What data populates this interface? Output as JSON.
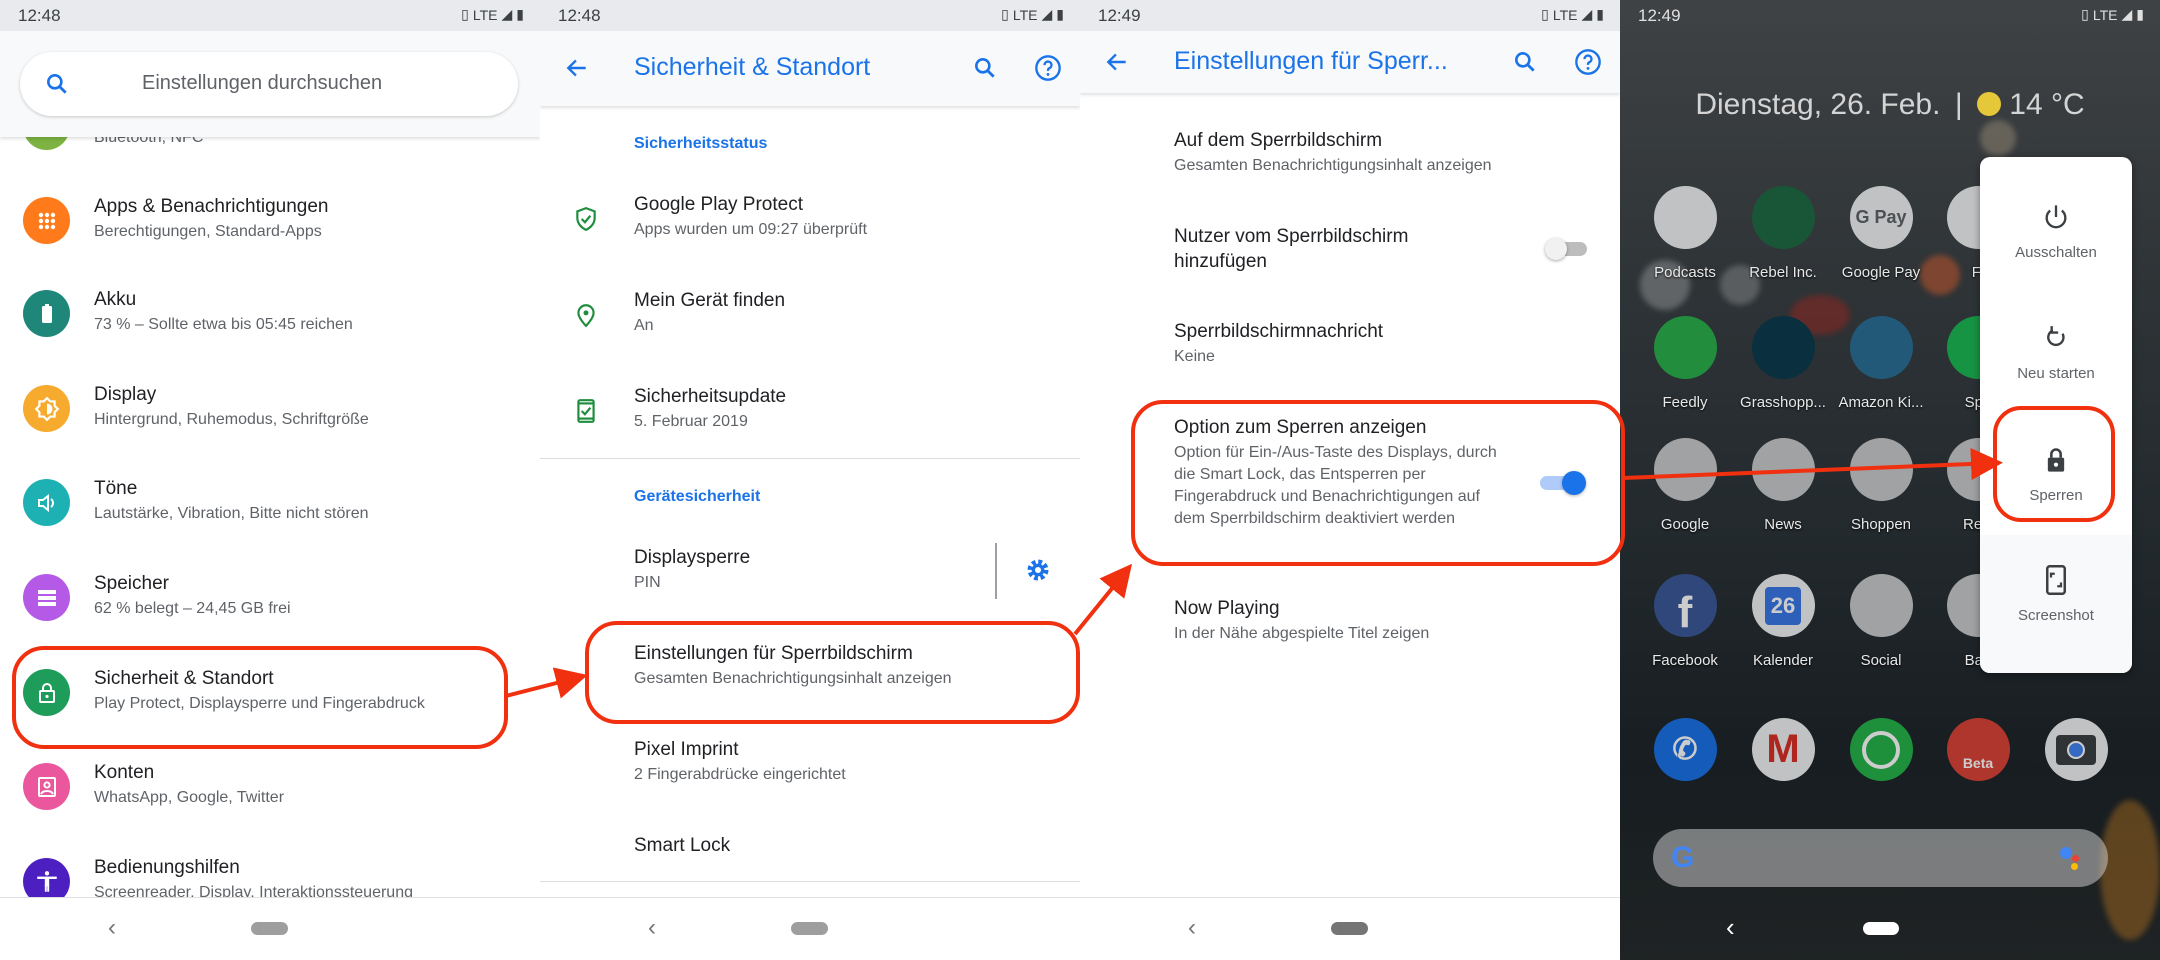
{
  "colors": {
    "accent": "#1a73e8",
    "annotation": "#f0300f",
    "primary_text": "#202124",
    "secondary_text": "#5f6368",
    "shield_green": "#1e8e3e"
  },
  "screen1": {
    "status": {
      "time": "12:48",
      "network": "LTE"
    },
    "search": {
      "placeholder": "Einstellungen durchsuchen",
      "icon": "search-icon"
    },
    "items": [
      {
        "title": "",
        "subtitle": "Bluetooth, NFC",
        "icon": "bluetooth-icon",
        "color": "#7cb342"
      },
      {
        "title": "Apps & Benachrichtigungen",
        "subtitle": "Berechtigungen, Standard-Apps",
        "icon": "apps-grid-icon",
        "color": "#ff7a1a"
      },
      {
        "title": "Akku",
        "subtitle": "73 % – Sollte etwa bis 05:45 reichen",
        "icon": "battery-icon",
        "color": "#1e877a"
      },
      {
        "title": "Display",
        "subtitle": "Hintergrund, Ruhemodus, Schriftgröße",
        "icon": "brightness-icon",
        "color": "#f6ab2f"
      },
      {
        "title": "Töne",
        "subtitle": "Lautstärke, Vibration, Bitte nicht stören",
        "icon": "volume-icon",
        "color": "#1eb1b4"
      },
      {
        "title": "Speicher",
        "subtitle": "62 % belegt – 24,45 GB frei",
        "icon": "storage-icon",
        "color": "#b45ae6"
      },
      {
        "title": "Sicherheit & Standort",
        "subtitle": "Play Protect, Displaysperre und Fingerabdruck",
        "icon": "lock-icon",
        "color": "#1e9c5a"
      },
      {
        "title": "Konten",
        "subtitle": "WhatsApp, Google, Twitter",
        "icon": "account-icon",
        "color": "#ea579c"
      },
      {
        "title": "Bedienungshilfen",
        "subtitle": "Screenreader, Display, Interaktionssteuerung",
        "icon": "accessibility-icon",
        "color": "#4c1fc0"
      }
    ]
  },
  "screen2": {
    "status": {
      "time": "12:48",
      "network": "LTE"
    },
    "appbar": {
      "title": "Sicherheit & Standort"
    },
    "sections": [
      {
        "header": "Sicherheitsstatus",
        "items": [
          {
            "title": "Google Play Protect",
            "subtitle": "Apps wurden um 09:27 überprüft",
            "icon": "shield-check-icon"
          },
          {
            "title": "Mein Gerät finden",
            "subtitle": "An",
            "icon": "location-pin-icon"
          },
          {
            "title": "Sicherheitsupdate",
            "subtitle": "5. Februar 2019",
            "icon": "phone-check-icon"
          }
        ]
      },
      {
        "header": "Gerätesicherheit",
        "items": [
          {
            "title": "Displaysperre",
            "subtitle": "PIN",
            "icon": "gear-icon"
          },
          {
            "title": "Einstellungen für Sperrbildschirm",
            "subtitle": "Gesamten Benachrichtigungsinhalt anzeigen"
          },
          {
            "title": "Pixel Imprint",
            "subtitle": "2 Fingerabdrücke eingerichtet"
          },
          {
            "title": "Smart Lock",
            "subtitle": ""
          }
        ]
      }
    ]
  },
  "screen3": {
    "status": {
      "time": "12:49",
      "network": "LTE"
    },
    "appbar": {
      "title": "Einstellungen für Sperr..."
    },
    "items": [
      {
        "title": "Auf dem Sperrbildschirm",
        "subtitle": "Gesamten Benachrichtigungsinhalt anzeigen"
      },
      {
        "title": "Nutzer vom Sperrbildschirm hinzufügen",
        "subtitle": "",
        "toggle": false
      },
      {
        "title": "Sperrbildschirmnachricht",
        "subtitle": "Keine"
      },
      {
        "title": "Option zum Sperren anzeigen",
        "subtitle": "Option für Ein-/Aus-Taste des Displays, durch die Smart Lock, das Entsperren per Fingerabdruck und Benachrichtigungen auf dem Sperrbildschirm deaktiviert werden",
        "toggle": true
      },
      {
        "title": "Now Playing",
        "subtitle": "In der Nähe abgespielte Titel zeigen"
      }
    ]
  },
  "screen4": {
    "status": {
      "time": "12:49",
      "network": "LTE"
    },
    "glance": {
      "date": "Dienstag, 26. Feb.",
      "separator": "|",
      "temperature": "14 °C",
      "weather_icon": "sun-icon"
    },
    "apps": [
      [
        {
          "label": "Podcasts",
          "color": "#f1f3f4"
        },
        {
          "label": "Rebel Inc.",
          "color": "#1f6b45"
        },
        {
          "label": "Google Pay",
          "color": "#f1f3f4",
          "glyph": "G Pay"
        },
        {
          "label": "Fi",
          "color": "#f1f3f4"
        }
      ],
      [
        {
          "label": "Feedly",
          "color": "#2bb24c"
        },
        {
          "label": "Grasshopp...",
          "color": "#0d3b4f"
        },
        {
          "label": "Amazon Ki...",
          "color": "#2a6f96"
        },
        {
          "label": "Spo",
          "color": "#1db954"
        }
      ],
      [
        {
          "label": "Google",
          "color": "#c8cacc"
        },
        {
          "label": "News",
          "color": "#c8cacc"
        },
        {
          "label": "Shoppen",
          "color": "#c8cacc"
        },
        {
          "label": "Reis",
          "color": "#c8cacc"
        }
      ],
      [
        {
          "label": "Facebook",
          "color": "#3b5998",
          "glyph": "f"
        },
        {
          "label": "Kalender",
          "color": "#f1f3f4",
          "glyph": "26"
        },
        {
          "label": "Social",
          "color": "#c8cacc"
        },
        {
          "label": "Ban",
          "color": "#c8cacc"
        }
      ]
    ],
    "dock": [
      {
        "name": "phone",
        "color": "#1a73e8"
      },
      {
        "name": "gmail",
        "color": "#f1f3f4",
        "glyph": "M"
      },
      {
        "name": "whatsapp",
        "color": "#25b34a"
      },
      {
        "name": "chrome-beta",
        "color": "#db4437",
        "glyph": "Beta"
      },
      {
        "name": "camera",
        "color": "#f1f3f4"
      }
    ],
    "power_menu": [
      {
        "label": "Ausschalten",
        "icon": "power-icon"
      },
      {
        "label": "Neu starten",
        "icon": "restart-icon"
      },
      {
        "label": "Sperren",
        "icon": "lock-icon"
      },
      {
        "label": "Screenshot",
        "icon": "screenshot-icon"
      }
    ]
  }
}
